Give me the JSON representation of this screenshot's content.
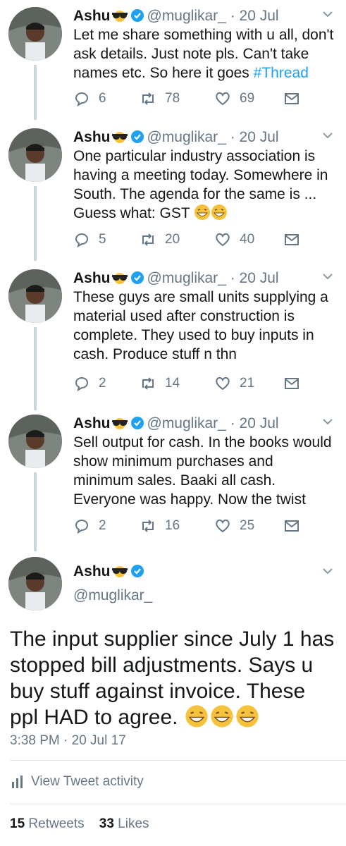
{
  "author": {
    "name": "Ashu",
    "handle": "@muglikar_",
    "separator": "·",
    "date": "20 Jul"
  },
  "tweets": [
    {
      "text": "Let me share something with u all, don't ask details. Just note pls. Can't take names etc. So here it goes",
      "hashtag": "#Thread",
      "replies": "6",
      "retweets": "78",
      "likes": "69"
    },
    {
      "text": "One particular industry association is having a meeting today. Somewhere in South. The agenda for the same is ... Guess what: GST",
      "replies": "5",
      "retweets": "20",
      "likes": "40"
    },
    {
      "text": "These guys are small units supplying a material used after construction is complete. They used to buy inputs in cash. Produce stuff n thn",
      "replies": "2",
      "retweets": "14",
      "likes": "21"
    },
    {
      "text": "Sell output for cash. In the books would show minimum purchases and minimum sales. Baaki all cash. Everyone was happy. Now the twist",
      "replies": "2",
      "retweets": "16",
      "likes": "25"
    }
  ],
  "main_tweet": {
    "text": "The input supplier since July 1 has stopped bill adjustments. Says u buy stuff against invoice. These ppl HAD to agree.",
    "timestamp": "3:38 PM · 20 Jul 17",
    "activity_label": "View Tweet activity",
    "retweets_count": "15",
    "retweets_label": "Retweets",
    "likes_count": "33",
    "likes_label": "Likes"
  },
  "icons": [
    "reply-icon",
    "retweet-icon",
    "like-icon",
    "dm-icon",
    "verified-icon",
    "chevron-down-icon",
    "sunglasses-emoji",
    "laughing-emoji",
    "activity-icon"
  ],
  "colors": {
    "accent": "#1da1f2",
    "muted": "#657786",
    "divider": "#e1e8ed"
  }
}
